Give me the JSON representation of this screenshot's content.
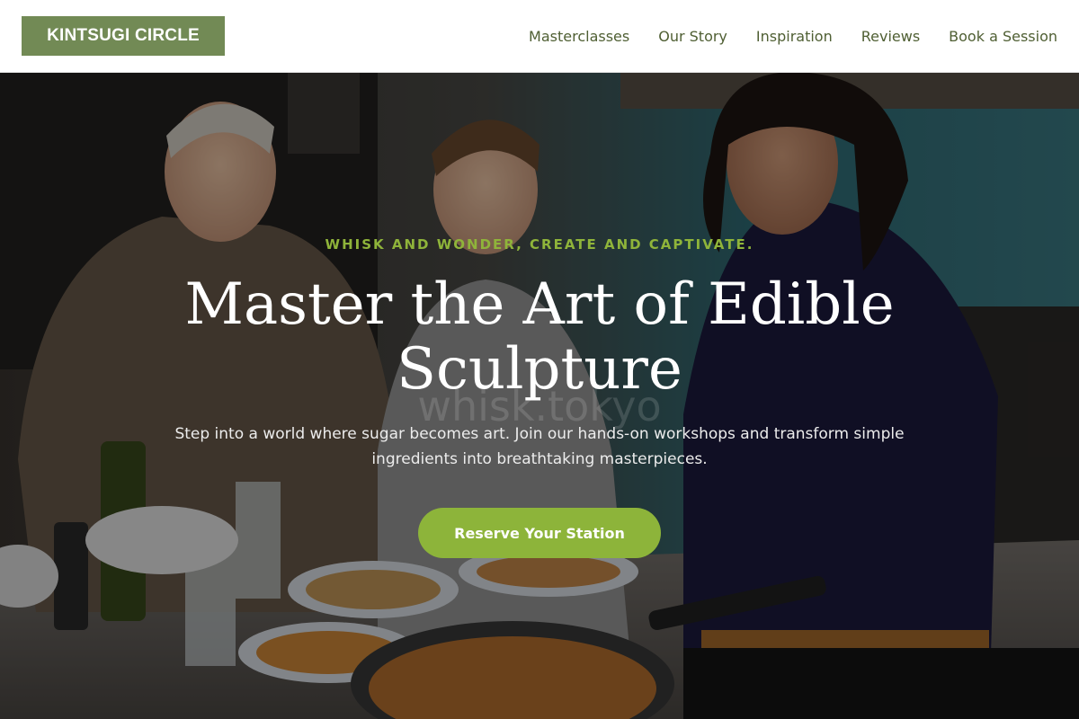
{
  "header": {
    "logo": "KINTSUGI CIRCLE",
    "nav": [
      {
        "label": "Masterclasses"
      },
      {
        "label": "Our Story"
      },
      {
        "label": "Inspiration"
      },
      {
        "label": "Reviews"
      },
      {
        "label": "Book a Session"
      }
    ]
  },
  "hero": {
    "image": "photo of three people smiling while plating food in a kitchen",
    "tagline": "WHISK AND WONDER, CREATE AND CAPTIVATE.",
    "title": "Master the Art of Edible Sculpture",
    "watermark": "whisk.tokyo",
    "subtitle": "Step into a world where sugar becomes art. Join our hands-on workshops and transform simple ingredients into breathtaking masterpieces.",
    "cta": "Reserve Your Station"
  },
  "colors": {
    "brand": "#728a55",
    "nav_text": "#4f5f33",
    "accent": "#8db43a",
    "tagline": "#8fb43a",
    "overlay": "rgba(0,0,0,0.42)"
  }
}
